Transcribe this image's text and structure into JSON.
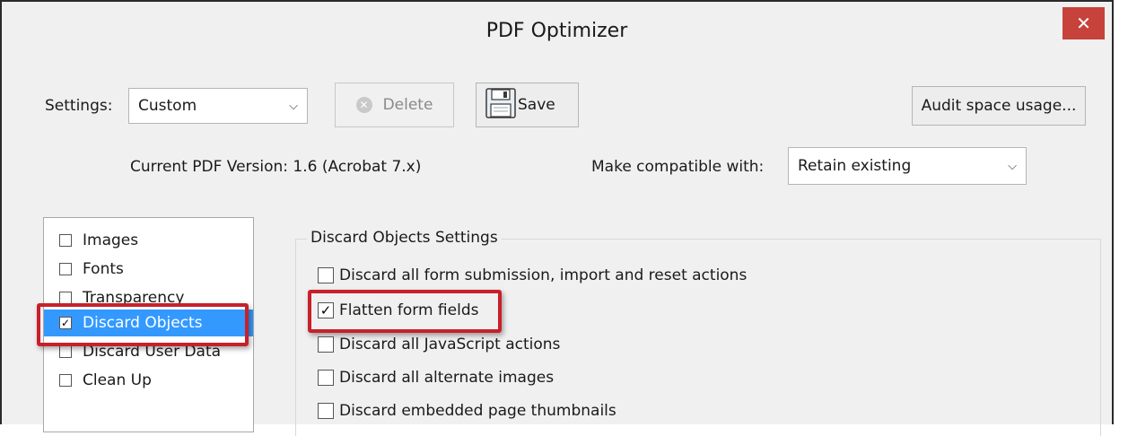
{
  "window": {
    "title": "PDF Optimizer",
    "close_label": "✕"
  },
  "settings": {
    "label": "Settings:",
    "value": "Custom",
    "delete_label": "Delete",
    "save_label": "Save",
    "audit_label": "Audit space usage..."
  },
  "version": {
    "current_text": "Current PDF Version: 1.6 (Acrobat 7.x)",
    "compat_label": "Make compatible with:",
    "compat_value": "Retain existing"
  },
  "sidebar": {
    "items": [
      {
        "label": "Images",
        "checked": false,
        "selected": false
      },
      {
        "label": "Fonts",
        "checked": false,
        "selected": false
      },
      {
        "label": "Transparency",
        "checked": false,
        "selected": false
      },
      {
        "label": "Discard Objects",
        "checked": true,
        "selected": true
      },
      {
        "label": "Discard User Data",
        "checked": false,
        "selected": false
      },
      {
        "label": "Clean Up",
        "checked": false,
        "selected": false
      }
    ]
  },
  "discard": {
    "title": "Discard Objects Settings",
    "options": [
      {
        "label": "Discard all form submission, import and reset actions",
        "checked": false
      },
      {
        "label": "Flatten form fields",
        "checked": true
      },
      {
        "label": "Discard all JavaScript actions",
        "checked": false
      },
      {
        "label": "Discard all alternate images",
        "checked": false
      },
      {
        "label": "Discard embedded page thumbnails",
        "checked": false
      }
    ]
  },
  "colors": {
    "accent": "#3399ff",
    "highlight": "#c8202a",
    "close": "#c7423a"
  }
}
